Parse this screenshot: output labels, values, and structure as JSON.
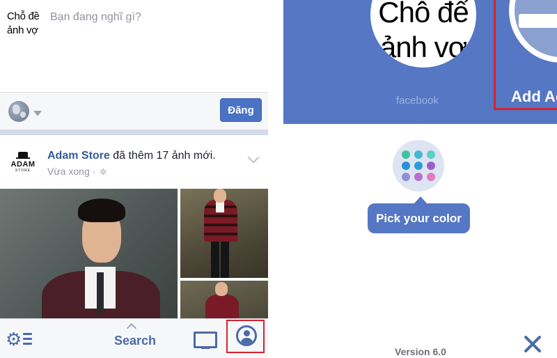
{
  "composer": {
    "thumb_text": "Chỗ đề\nảnh vợ",
    "placeholder": "Bạn đang nghĩ gì?",
    "post_button": "Đăng"
  },
  "post": {
    "author": "Adam Store",
    "action": " đã thêm 17 ảnh mới.",
    "time": "Vừa xong",
    "time_sep": " · ",
    "logo_text": "ADAM",
    "logo_subtext": "STORE"
  },
  "tabbar": {
    "search_label": "Search",
    "icons": [
      "gear-icon",
      "list-icon",
      "chevron-up-icon",
      "monitor-icon",
      "profile-icon"
    ]
  },
  "right": {
    "avatar_text": "Chỗ để\nảnh vợ",
    "brand_label": "facebook",
    "add_account_label": "Add Ac",
    "pick_color_label": "Pick your color",
    "version_label": "Version 6.0",
    "palette_colors": [
      "#3ec49e",
      "#43b9d9",
      "#59d0c8",
      "#2a90d9",
      "#2c9bd8",
      "#9a5fc7",
      "#8e8fd6",
      "#b86fd0",
      "#e07cbc"
    ]
  },
  "colors": {
    "facebook_blue": "#5577c4",
    "link_blue": "#365899",
    "highlight_red": "#d3232f"
  }
}
